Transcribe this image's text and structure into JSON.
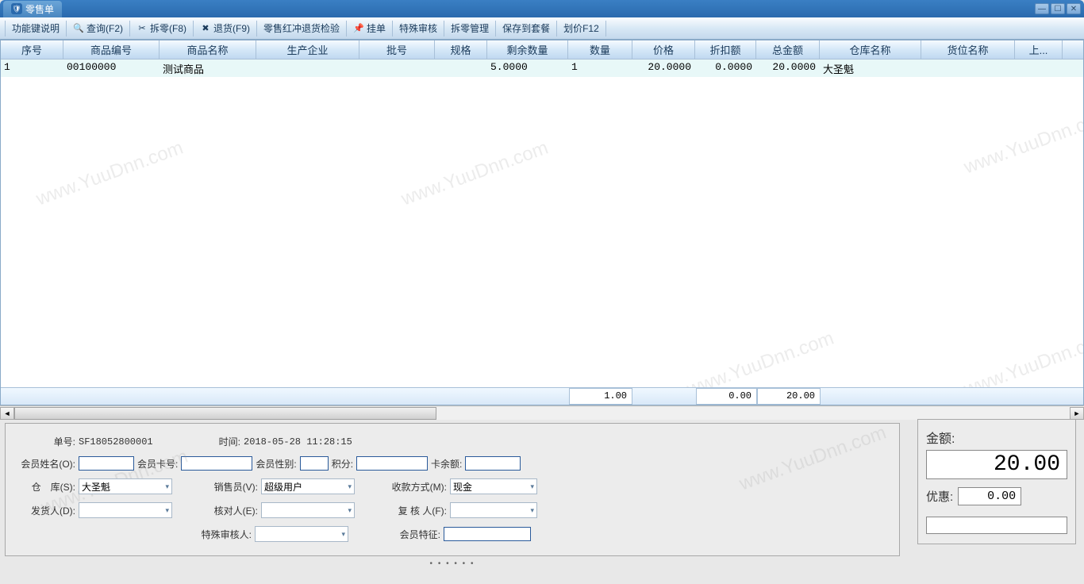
{
  "window": {
    "title": "零售单"
  },
  "toolbar": {
    "help": "功能键说明",
    "query": "查询(F2)",
    "split": "拆零(F8)",
    "return": "退货(F9)",
    "return_check": "零售红冲退货检验",
    "hold": "挂单",
    "special_audit": "特殊审核",
    "split_manage": "拆零管理",
    "save_set": "保存到套餐",
    "price_f12": "划价F12"
  },
  "columns": {
    "c1": "序号",
    "c2": "商品编号",
    "c3": "商品名称",
    "c4": "生产企业",
    "c5": "批号",
    "c6": "规格",
    "c7": "剩余数量",
    "c8": "数量",
    "c9": "价格",
    "c10": "折扣额",
    "c11": "总金额",
    "c12": "仓库名称",
    "c13": "货位名称",
    "c14": "上..."
  },
  "rows": [
    {
      "c1": "1",
      "c2": "00100000",
      "c3": "测试商品",
      "c4": "",
      "c5": "",
      "c6": "",
      "c7": "5.0000",
      "c8": "1",
      "c9": "20.0000",
      "c10": "0.0000",
      "c11": "20.0000",
      "c12": "大圣魁",
      "c13": "",
      "c14": ""
    }
  ],
  "summary": {
    "s1": "1.00",
    "s2": "0.00",
    "s3": "20.00"
  },
  "form": {
    "order_no_lbl": "单号:",
    "order_no": "SF18052800001",
    "time_lbl": "时间:",
    "time": "2018-05-28 11:28:15",
    "member_name_lbl": "会员姓名(O):",
    "member_card_lbl": "会员卡号:",
    "member_sex_lbl": "会员性别:",
    "points_lbl": "积分:",
    "card_balance_lbl": "卡余额:",
    "warehouse_lbl": "仓　库(S):",
    "warehouse": "大圣魁",
    "salesman_lbl": "销售员(V):",
    "salesman": "超级用户",
    "pay_method_lbl": "收款方式(M):",
    "pay_method": "现金",
    "shipper_lbl": "发货人(D):",
    "checker_lbl": "核对人(E):",
    "reviewer_lbl": "复 核 人(F):",
    "special_auditor_lbl": "特殊审核人:",
    "member_feature_lbl": "会员特征:"
  },
  "amount": {
    "lbl": "金额:",
    "value": "20.00",
    "disc_lbl": "优惠:",
    "disc_value": "0.00"
  },
  "watermark": "www.YuuDnn.com"
}
